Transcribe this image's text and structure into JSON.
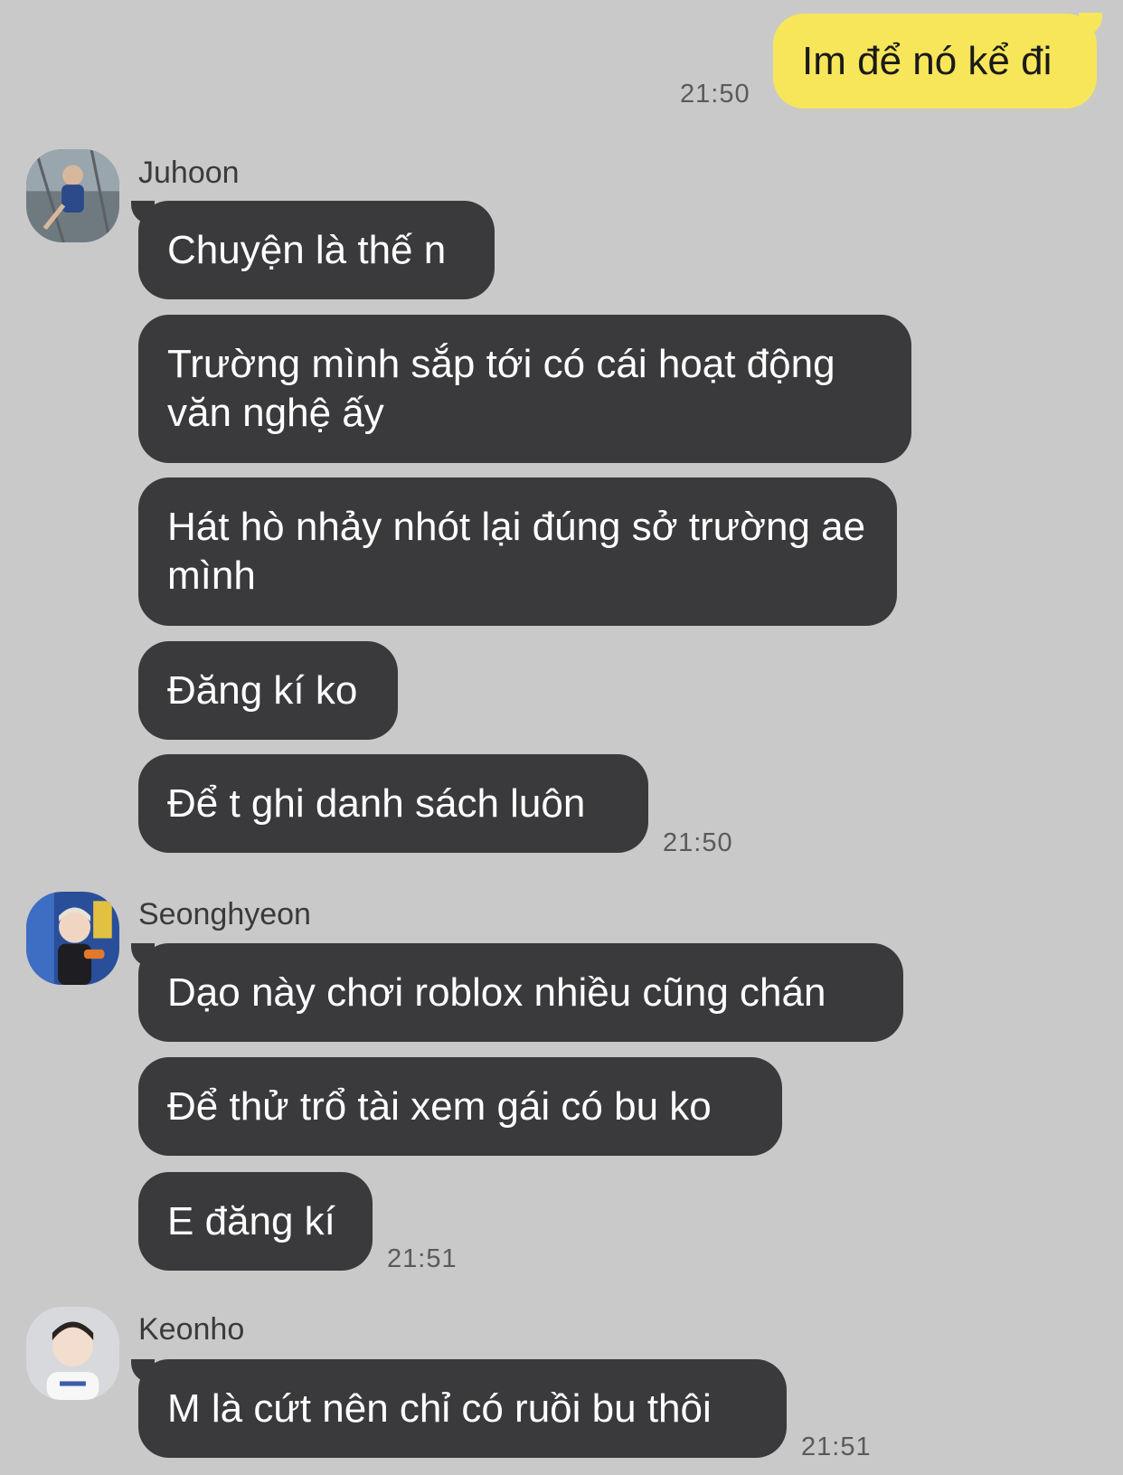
{
  "chat": {
    "outgoing": [
      {
        "text": "Im để nó kể đi",
        "time": "21:50"
      }
    ],
    "groups": [
      {
        "sender": "Juhoon",
        "avatar_icon": "avatar-juhoon-icon",
        "messages": [
          "Chuyện là thế n",
          "Trường mình sắp tới có cái hoạt động văn nghệ ấy",
          "Hát hò nhảy nhót lại đúng sở trường ae mình",
          "Đăng kí ko",
          "Để t ghi danh sách luôn"
        ],
        "time": "21:50"
      },
      {
        "sender": "Seonghyeon",
        "avatar_icon": "avatar-seonghyeon-icon",
        "messages": [
          "Dạo này chơi roblox nhiều cũng chán",
          "Để thử trổ tài xem gái có bu ko",
          "E đăng kí"
        ],
        "time": "21:51"
      },
      {
        "sender": "Keonho",
        "avatar_icon": "avatar-keonho-icon",
        "messages": [
          "M là cứt nên chỉ có ruồi bu thôi"
        ],
        "time": "21:51"
      }
    ]
  },
  "colors": {
    "background": "#c9c9c9",
    "incoming_bubble": "#3a3a3c",
    "outgoing_bubble": "#f7e65a"
  }
}
